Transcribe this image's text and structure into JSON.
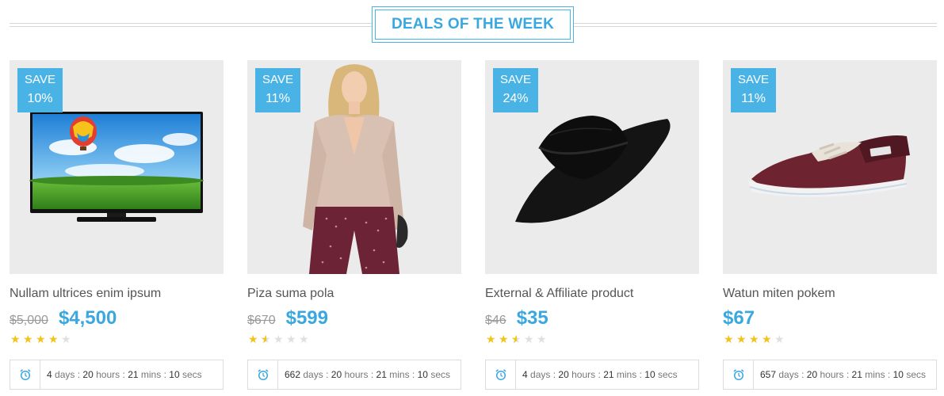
{
  "section": {
    "title": "DEALS OF THE WEEK"
  },
  "colors": {
    "accent": "#4ab3e6",
    "price": "#3aa8e0",
    "star": "#f0c419",
    "thumb_bg": "#ebebeb"
  },
  "countdown_labels": {
    "days": "days",
    "hours": "hours",
    "mins": "mins",
    "secs": "secs",
    "sep": ":"
  },
  "products": [
    {
      "save_label": "SAVE",
      "save_pct": "10%",
      "image": "tv-image",
      "name": "Nullam ultrices enim ipsum",
      "old_price": "$5,000",
      "new_price": "$4,500",
      "rating": 4,
      "rating_max": 5,
      "days": "4",
      "hours": "20",
      "mins": "21",
      "secs": "10"
    },
    {
      "save_label": "SAVE",
      "save_pct": "11%",
      "image": "model-image",
      "name": "Piza suma pola",
      "old_price": "$670",
      "new_price": "$599",
      "rating": 1.5,
      "rating_max": 5,
      "days": "662",
      "hours": "20",
      "mins": "21",
      "secs": "10"
    },
    {
      "save_label": "SAVE",
      "save_pct": "24%",
      "image": "hat-image",
      "name": "External & Affiliate product",
      "old_price": "$46",
      "new_price": "$35",
      "rating": 2.5,
      "rating_max": 5,
      "days": "4",
      "hours": "20",
      "mins": "21",
      "secs": "10"
    },
    {
      "save_label": "SAVE",
      "save_pct": "11%",
      "image": "shoe-image",
      "name": "Watun miten pokem",
      "old_price": "",
      "new_price": "$67",
      "rating": 4,
      "rating_max": 5,
      "days": "657",
      "hours": "20",
      "mins": "21",
      "secs": "10"
    }
  ]
}
